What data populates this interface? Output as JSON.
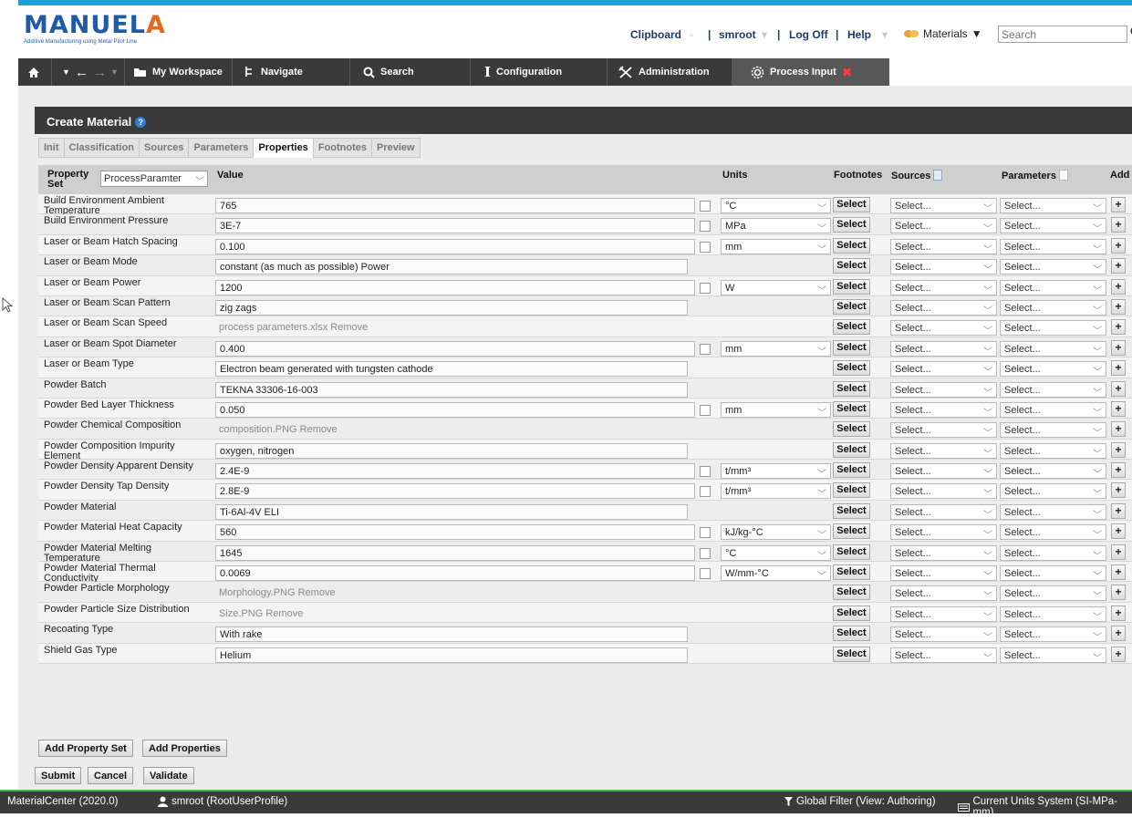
{
  "app": {
    "logo_main": "MANUEL",
    "logo_accent": "A",
    "logo_tagline": "Additive Manufacturing using Metal Pilot Line"
  },
  "header": {
    "clipboard": "Clipboard",
    "user": "smroot",
    "logoff": "Log Off",
    "help": "Help",
    "materials_label": "Materials",
    "search_placeholder": "Search"
  },
  "nav": {
    "workspace": "My Workspace",
    "navigate": "Navigate",
    "search": "Search",
    "configuration": "Configuration",
    "administration": "Administration",
    "process_input": "Process Input"
  },
  "page": {
    "title": "Create Material",
    "tabs": [
      "Init",
      "Classification",
      "Sources",
      "Parameters",
      "Properties",
      "Footnotes",
      "Preview"
    ],
    "active_tab": "Properties"
  },
  "grid": {
    "headers": {
      "property_set": "Property Set",
      "property_set_value": "ProcessParamter",
      "value": "Value",
      "units": "Units",
      "footnotes": "Footnotes",
      "sources": "Sources",
      "parameters": "Parameters",
      "add": "Add"
    },
    "select_label": "Select",
    "dropdown_placeholder": "Select...",
    "add_symbol": "+",
    "rows": [
      {
        "label": "Build Environment Ambient Temperature",
        "value": "765",
        "unit": "°C",
        "kind": "num"
      },
      {
        "label": "Build Environment Pressure",
        "value": "3E-7",
        "unit": "MPa",
        "kind": "num"
      },
      {
        "label": "Laser or Beam Hatch Spacing",
        "value": "0.100",
        "unit": "mm",
        "kind": "num"
      },
      {
        "label": "Laser or Beam Mode",
        "value": "constant (as much as possible) Power",
        "unit": "",
        "kind": "text"
      },
      {
        "label": "Laser or Beam Power",
        "value": "1200",
        "unit": "W",
        "kind": "num"
      },
      {
        "label": "Laser or Beam Scan Pattern",
        "value": "zig zags",
        "unit": "",
        "kind": "text"
      },
      {
        "label": "Laser or Beam Scan Speed",
        "value": "process parameters.xlsx Remove",
        "unit": "",
        "kind": "file"
      },
      {
        "label": "Laser or Beam Spot Diameter",
        "value": "0.400",
        "unit": "mm",
        "kind": "num"
      },
      {
        "label": "Laser or Beam Type",
        "value": "Electron beam generated with tungsten cathode",
        "unit": "",
        "kind": "text"
      },
      {
        "label": "Powder Batch",
        "value": "TEKNA 33306-16-003",
        "unit": "",
        "kind": "text"
      },
      {
        "label": "Powder Bed Layer Thickness",
        "value": "0.050",
        "unit": "mm",
        "kind": "num"
      },
      {
        "label": "Powder Chemical Composition",
        "value": "composition.PNG Remove",
        "unit": "",
        "kind": "file"
      },
      {
        "label": "Powder Composition Impurity Element",
        "value": "oxygen, nitrogen",
        "unit": "",
        "kind": "text"
      },
      {
        "label": "Powder Density Apparent Density",
        "value": "2.4E-9",
        "unit": "t/mm³",
        "kind": "num"
      },
      {
        "label": "Powder Density Tap Density",
        "value": "2.8E-9",
        "unit": "t/mm³",
        "kind": "num"
      },
      {
        "label": "Powder Material",
        "value": "Ti-6Al-4V ELI",
        "unit": "",
        "kind": "text"
      },
      {
        "label": "Powder Material Heat Capacity",
        "value": "560",
        "unit": "kJ/kg-°C",
        "kind": "num"
      },
      {
        "label": "Powder Material Melting Temperature",
        "value": "1645",
        "unit": "°C",
        "kind": "num"
      },
      {
        "label": "Powder Material Thermal Conductivity",
        "value": "0.0069",
        "unit": "W/mm-°C",
        "kind": "num"
      },
      {
        "label": "Powder Particle Morphology",
        "value": "Morphology.PNG Remove",
        "unit": "",
        "kind": "file"
      },
      {
        "label": "Powder Particle Size Distribution",
        "value": "Size.PNG Remove",
        "unit": "",
        "kind": "file"
      },
      {
        "label": "Recoating Type",
        "value": "With rake",
        "unit": "",
        "kind": "text"
      },
      {
        "label": "Shield Gas Type",
        "value": "Helium",
        "unit": "",
        "kind": "text"
      }
    ]
  },
  "buttons": {
    "add_property_set": "Add Property Set",
    "add_properties": "Add Properties",
    "submit": "Submit",
    "cancel": "Cancel",
    "validate": "Validate"
  },
  "status": {
    "app_version": "MaterialCenter (2020.0)",
    "user_profile": "smroot (RootUserProfile)",
    "global_filter": "Global Filter (View: Authoring)",
    "units_system": "Current Units System (SI-MPa-mm)"
  },
  "colors": {
    "brand_blue": "#1f5aa6",
    "brand_orange": "#e36a1c",
    "navbar": "#3a3a3a",
    "status_green": "#3db54a"
  }
}
